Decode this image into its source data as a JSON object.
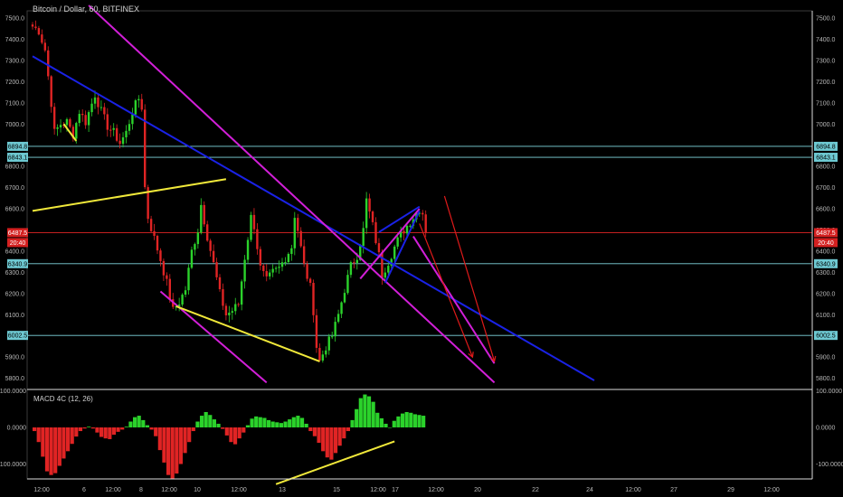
{
  "header": {
    "title": "Bitcoin / Dollar, 60, BITFINEX"
  },
  "macd": {
    "label": "MACD 4C (12, 26)"
  },
  "colors": {
    "background": "#000000",
    "up": "#2bd22b",
    "down": "#e02424",
    "blue_line": "#1a22e6",
    "magenta_line": "#d21fd8",
    "yellow_line": "#f0e83a",
    "arrow": "#e01a1a",
    "level_line": "#7fd8e0",
    "current_line": "#e02424"
  },
  "chart_data": {
    "type": "candlestick",
    "symbol": "Bitcoin / Dollar",
    "interval": "60",
    "exchange": "BITFINEX",
    "ylim": [
      5750,
      7550
    ],
    "y_ticks": [
      "7500.0",
      "7400.0",
      "7300.0",
      "7200.0",
      "7100.0",
      "7000.0",
      "6900.0",
      "6800.0",
      "6700.0",
      "6600.0",
      "6500.0",
      "6400.0",
      "6300.0",
      "6200.0",
      "6100.0",
      "6000.0",
      "5900.0",
      "5800.0"
    ],
    "x_ticks": [
      "12:00",
      "6",
      "12:00",
      "8",
      "12:00",
      "10",
      "12:00",
      "13",
      "15",
      "12:00",
      "17",
      "12:00",
      "20",
      "22",
      "24",
      "12:00",
      "27",
      "29",
      "12:00"
    ],
    "price_path": [
      [
        0,
        7460
      ],
      [
        2,
        7440
      ],
      [
        4,
        7350
      ],
      [
        6,
        7100
      ],
      [
        7,
        6960
      ],
      [
        9,
        7000
      ],
      [
        11,
        7010
      ],
      [
        13,
        6950
      ],
      [
        15,
        7060
      ],
      [
        17,
        7010
      ],
      [
        20,
        7140
      ],
      [
        22,
        7060
      ],
      [
        24,
        6990
      ],
      [
        26,
        6960
      ],
      [
        28,
        6910
      ],
      [
        30,
        6960
      ],
      [
        32,
        7060
      ],
      [
        34,
        7120
      ],
      [
        35,
        7080
      ],
      [
        36,
        6700
      ],
      [
        37,
        6560
      ],
      [
        39,
        6460
      ],
      [
        41,
        6360
      ],
      [
        43,
        6250
      ],
      [
        45,
        6120
      ],
      [
        47,
        6160
      ],
      [
        49,
        6220
      ],
      [
        51,
        6400
      ],
      [
        53,
        6500
      ],
      [
        54,
        6620
      ],
      [
        56,
        6470
      ],
      [
        58,
        6340
      ],
      [
        60,
        6200
      ],
      [
        62,
        6100
      ],
      [
        64,
        6120
      ],
      [
        66,
        6150
      ],
      [
        68,
        6370
      ],
      [
        70,
        6560
      ],
      [
        71,
        6520
      ],
      [
        73,
        6320
      ],
      [
        75,
        6260
      ],
      [
        77,
        6300
      ],
      [
        79,
        6320
      ],
      [
        81,
        6370
      ],
      [
        83,
        6420
      ],
      [
        84,
        6570
      ],
      [
        85,
        6500
      ],
      [
        87,
        6330
      ],
      [
        89,
        6230
      ],
      [
        90,
        6120
      ],
      [
        91,
        5950
      ],
      [
        92,
        5880
      ],
      [
        94,
        5950
      ],
      [
        96,
        6000
      ],
      [
        98,
        6100
      ],
      [
        100,
        6220
      ],
      [
        102,
        6330
      ],
      [
        104,
        6380
      ],
      [
        106,
        6500
      ],
      [
        107,
        6640
      ],
      [
        109,
        6520
      ],
      [
        111,
        6380
      ],
      [
        112,
        6290
      ],
      [
        114,
        6350
      ],
      [
        116,
        6420
      ],
      [
        118,
        6480
      ],
      [
        120,
        6520
      ],
      [
        122,
        6560
      ],
      [
        124,
        6600
      ],
      [
        125,
        6580
      ],
      [
        126,
        6487
      ]
    ],
    "horizontal_levels": [
      {
        "price": 6894.8,
        "label": "6894.8"
      },
      {
        "price": 6843.1,
        "label": "6843.1"
      },
      {
        "price": 6340.9,
        "label": "6340.9"
      },
      {
        "price": 6002.5,
        "label": "6002.5"
      }
    ],
    "current_price": {
      "price": 6487.5,
      "label": "6487.5",
      "countdown": "20:40"
    },
    "macd": {
      "name": "MACD 4C (12, 26)",
      "ylim": [
        -150,
        110
      ],
      "y_ticks": [
        "100.0000",
        "0.0000",
        "-100.0000"
      ],
      "histogram": [
        -10,
        -40,
        -80,
        -120,
        -130,
        -125,
        -105,
        -85,
        -65,
        -45,
        -25,
        -10,
        -3,
        2,
        -3,
        -14,
        -26,
        -30,
        -32,
        -20,
        -12,
        -6,
        2,
        16,
        28,
        32,
        20,
        6,
        -6,
        -24,
        -62,
        -96,
        -130,
        -140,
        -126,
        -100,
        -70,
        -40,
        -10,
        16,
        32,
        42,
        34,
        22,
        10,
        -4,
        -22,
        -40,
        -46,
        -30,
        -14,
        6,
        24,
        30,
        28,
        26,
        20,
        16,
        14,
        12,
        16,
        22,
        28,
        32,
        26,
        10,
        -10,
        -24,
        -42,
        -65,
        -82,
        -88,
        -70,
        -50,
        -30,
        -10,
        20,
        50,
        80,
        90,
        85,
        70,
        40,
        25,
        10,
        0,
        18,
        30,
        38,
        42,
        40,
        36,
        34,
        32
      ]
    },
    "annotations": {
      "trendlines": [
        {
          "color": "blue",
          "from": [
            0,
            7320
          ],
          "to": [
            180,
            5790
          ]
        },
        {
          "color": "magenta",
          "from": [
            18,
            7560
          ],
          "to": [
            148,
            5780
          ]
        },
        {
          "color": "magenta",
          "from": [
            41,
            6210
          ],
          "to": [
            75,
            5780
          ]
        },
        {
          "color": "magenta",
          "from": [
            105,
            6270
          ],
          "to": [
            124,
            6600
          ]
        },
        {
          "color": "magenta",
          "from": [
            122,
            6470
          ],
          "to": [
            148,
            5870
          ]
        },
        {
          "color": "yellow",
          "from": [
            0,
            6590
          ],
          "to": [
            62,
            6740
          ]
        },
        {
          "color": "yellow",
          "from": [
            46,
            6140
          ],
          "to": [
            92,
            5880
          ]
        },
        {
          "color": "yellow",
          "from": [
            10,
            7000
          ],
          "to": [
            14,
            6920
          ]
        }
      ],
      "channel_lines": [
        {
          "color": "blue",
          "from": [
            111,
            6490
          ],
          "to": [
            124,
            6610
          ]
        },
        {
          "color": "blue",
          "from": [
            113,
            6250
          ],
          "to": [
            124,
            6590
          ]
        }
      ],
      "arrows": [
        {
          "color": "red",
          "from": [
            124,
            6530
          ],
          "to": [
            141,
            5900
          ]
        },
        {
          "color": "red",
          "from": [
            132,
            6660
          ],
          "to": [
            148,
            5880
          ]
        }
      ],
      "macd_divergence": {
        "color": "yellow",
        "from": [
          78,
          -155
        ],
        "to": [
          116,
          -38
        ]
      }
    }
  }
}
